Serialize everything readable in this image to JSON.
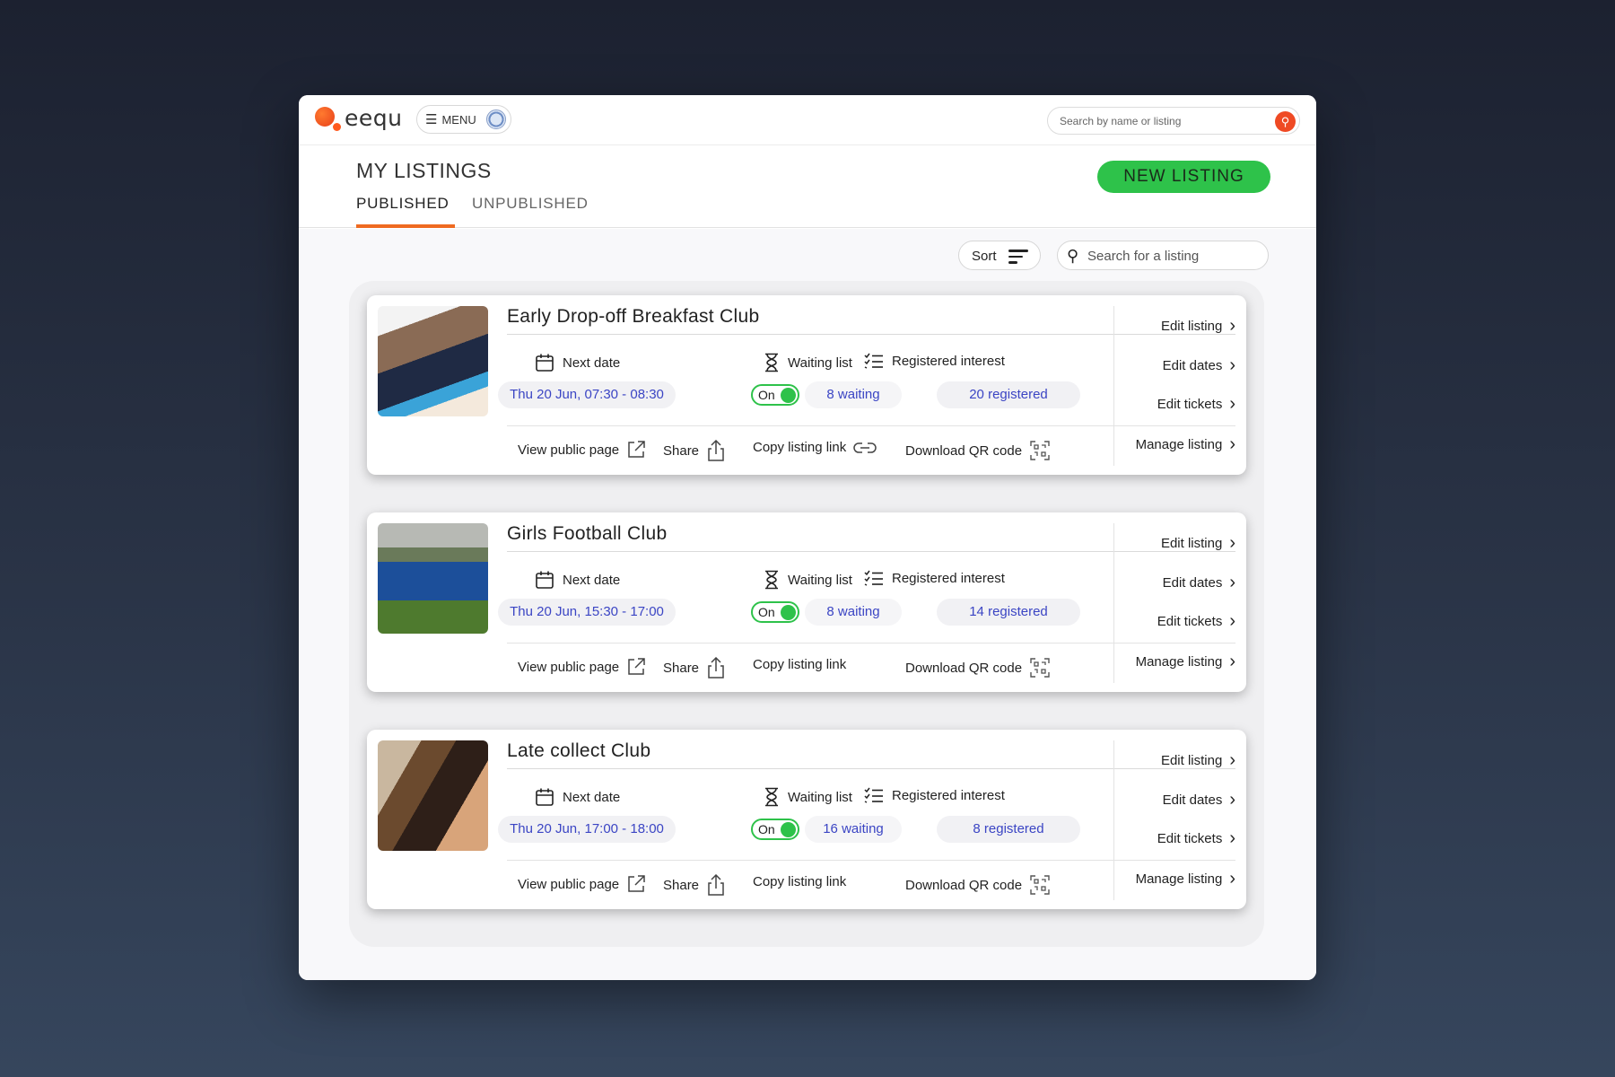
{
  "topbar": {
    "logo_text": "eequ",
    "menu_label": "MENU",
    "search_placeholder": "Search by name or listing"
  },
  "header": {
    "title": "MY LISTINGS",
    "tabs": [
      {
        "label": "PUBLISHED",
        "active": true
      },
      {
        "label": "UNPUBLISHED",
        "active": false
      }
    ],
    "new_listing_label": "NEW LISTING"
  },
  "toolbar": {
    "sort_label": "Sort",
    "search_placeholder": "Search for a listing"
  },
  "labels": {
    "next_date": "Next date",
    "waiting_list": "Waiting list",
    "registered_interest": "Registered interest",
    "view_public_page": "View public page",
    "share": "Share",
    "copy_listing_link": "Copy listing link",
    "download_qr": "Download QR code",
    "edit_listing": "Edit listing",
    "edit_dates": "Edit dates",
    "edit_tickets": "Edit tickets",
    "manage_listing": "Manage listing",
    "toggle_on": "On"
  },
  "listings": [
    {
      "title": "Early Drop-off Breakfast Club",
      "next_date": "Thu 20 Jun, 07:30 - 08:30",
      "waiting_on": true,
      "waiting": "8 waiting",
      "registered": "20 registered"
    },
    {
      "title": "Girls Football Club",
      "next_date": "Thu 20 Jun, 15:30 - 17:00",
      "waiting_on": true,
      "waiting": "8 waiting",
      "registered": "14 registered"
    },
    {
      "title": "Late collect Club",
      "next_date": "Thu 20 Jun, 17:00 - 18:00",
      "waiting_on": true,
      "waiting": "16 waiting",
      "registered": "8 registered"
    }
  ],
  "colors": {
    "accent_orange": "#ef6a21",
    "primary_green": "#2ec24a",
    "link_blue": "#3b45c4"
  }
}
